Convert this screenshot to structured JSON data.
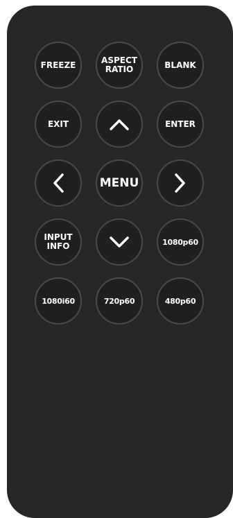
{
  "remote": {
    "buttons": {
      "freeze": "FREEZE",
      "aspect_ratio": "ASPECT\nRATIO",
      "blank": "BLANK",
      "exit": "EXIT",
      "up": "up-arrow-icon",
      "enter": "ENTER",
      "left": "left-arrow-icon",
      "menu": "MENU",
      "right": "right-arrow-icon",
      "input_info": "INPUT\nINFO",
      "down": "down-arrow-icon",
      "r1080p60": "1080p60",
      "r1080i60": "1080i60",
      "r720p60": "720p60",
      "r480p60": "480p60"
    },
    "colors": {
      "body": "#262626",
      "button": "#1f1f1f",
      "button_border": "#4a4a4a",
      "label": "#ffffff"
    }
  }
}
